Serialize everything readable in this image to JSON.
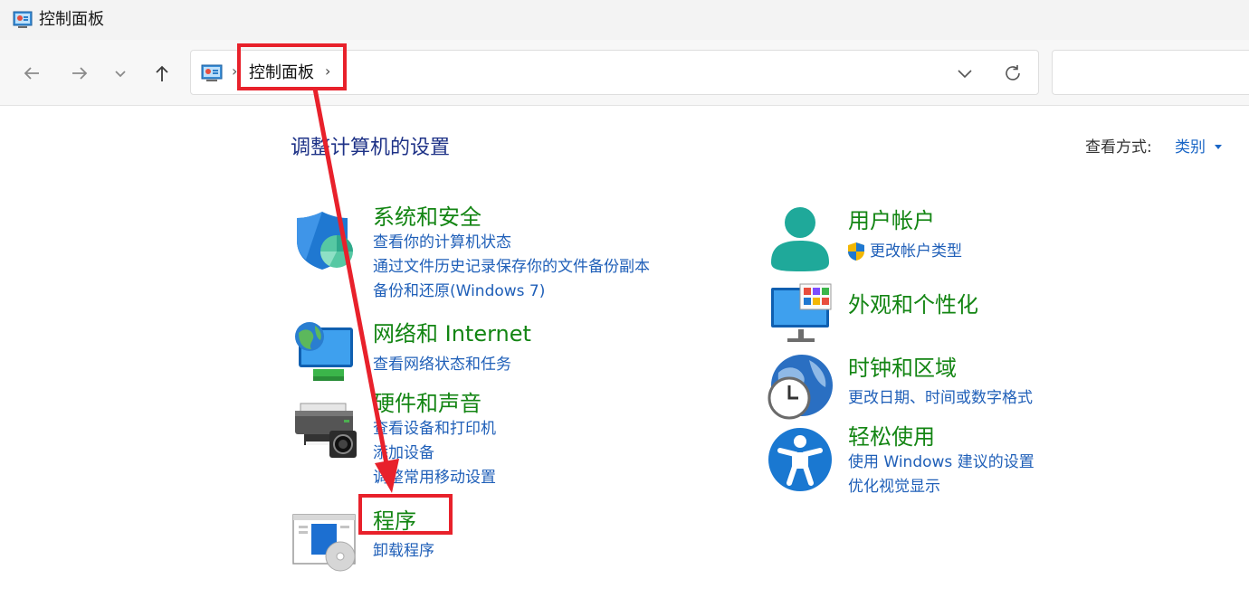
{
  "window": {
    "title": "控制面板"
  },
  "address": {
    "breadcrumb": "控制面板",
    "search_placeholder": ""
  },
  "main": {
    "title": "调整计算机的设置",
    "view_by_label": "查看方式:",
    "view_by_value": "类别"
  },
  "left_categories": [
    {
      "title": "系统和安全",
      "icon": "shield-icon",
      "links": [
        "查看你的计算机状态",
        "通过文件历史记录保存你的文件备份副本",
        "备份和还原(Windows 7)"
      ]
    },
    {
      "title": "网络和 Internet",
      "icon": "network-globe-icon",
      "links": [
        "查看网络状态和任务"
      ]
    },
    {
      "title": "硬件和声音",
      "icon": "printer-icon",
      "links": [
        "查看设备和打印机",
        "添加设备",
        "调整常用移动设置"
      ]
    },
    {
      "title": "程序",
      "icon": "programs-disc-icon",
      "links": [
        "卸载程序"
      ]
    }
  ],
  "right_categories": [
    {
      "title": "用户帐户",
      "icon": "user-account-icon",
      "links": [
        "更改帐户类型"
      ]
    },
    {
      "title": "外观和个性化",
      "icon": "monitor-personalize-icon",
      "links": []
    },
    {
      "title": "时钟和区域",
      "icon": "clock-globe-icon",
      "links": [
        "更改日期、时间或数字格式"
      ]
    },
    {
      "title": "轻松使用",
      "icon": "accessibility-icon",
      "links": [
        "使用 Windows 建议的设置",
        "优化视觉显示"
      ]
    }
  ],
  "colors": {
    "category_title": "#138513",
    "link": "#1f5fb8",
    "page_title": "#1e3287",
    "annotation": "#e8212b"
  }
}
